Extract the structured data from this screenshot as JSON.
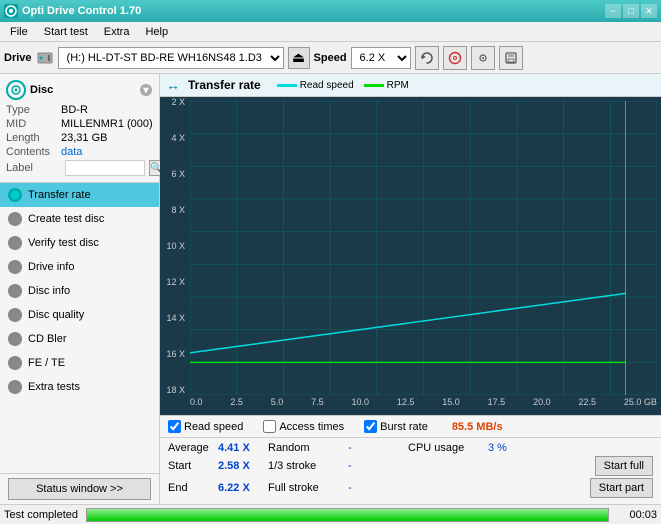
{
  "titlebar": {
    "title": "Opti Drive Control 1.70",
    "minimize": "−",
    "maximize": "□",
    "close": "✕"
  },
  "menu": {
    "items": [
      "File",
      "Start test",
      "Extra",
      "Help"
    ]
  },
  "drive_toolbar": {
    "drive_label": "Drive",
    "drive_value": "(H:)  HL-DT-ST BD-RE  WH16NS48 1.D3",
    "speed_label": "Speed",
    "speed_value": "6.2 X"
  },
  "disc": {
    "type_label": "Type",
    "type_value": "BD-R",
    "mid_label": "MID",
    "mid_value": "MILLENMR1 (000)",
    "length_label": "Length",
    "length_value": "23,31 GB",
    "contents_label": "Contents",
    "contents_value": "data",
    "label_label": "Label",
    "label_value": ""
  },
  "nav": {
    "items": [
      {
        "id": "transfer-rate",
        "label": "Transfer rate",
        "active": true
      },
      {
        "id": "create-test-disc",
        "label": "Create test disc",
        "active": false
      },
      {
        "id": "verify-test-disc",
        "label": "Verify test disc",
        "active": false
      },
      {
        "id": "drive-info",
        "label": "Drive info",
        "active": false
      },
      {
        "id": "disc-info",
        "label": "Disc info",
        "active": false
      },
      {
        "id": "disc-quality",
        "label": "Disc quality",
        "active": false
      },
      {
        "id": "cd-bler",
        "label": "CD Bler",
        "active": false
      },
      {
        "id": "fe-te",
        "label": "FE / TE",
        "active": false
      },
      {
        "id": "extra-tests",
        "label": "Extra tests",
        "active": false
      }
    ],
    "status_window_btn": "Status window >>"
  },
  "chart": {
    "title": "Transfer rate",
    "legend": [
      {
        "label": "Read speed",
        "color": "#00dddd"
      },
      {
        "label": "RPM",
        "color": "#00dd00"
      }
    ],
    "y_labels": [
      "18 X",
      "16 X",
      "14 X",
      "12 X",
      "10 X",
      "8 X",
      "6 X",
      "4 X",
      "2 X"
    ],
    "x_labels": [
      "0.0",
      "2.5",
      "5.0",
      "7.5",
      "10.0",
      "12.5",
      "15.0",
      "17.5",
      "20.0",
      "22.5",
      "25.0 GB"
    ],
    "checkboxes": [
      {
        "label": "Read speed",
        "checked": true
      },
      {
        "label": "Access times",
        "checked": false
      },
      {
        "label": "Burst rate",
        "checked": true
      }
    ],
    "burst_rate": "85.5 MB/s"
  },
  "stats": {
    "rows": [
      {
        "label1": "Average",
        "val1": "4.41 X",
        "label2": "Random",
        "val2": "-",
        "label3": "CPU usage",
        "val3": "3 %",
        "btn": null
      },
      {
        "label1": "Start",
        "val1": "2.58 X",
        "label2": "1/3 stroke",
        "val2": "-",
        "label3": "",
        "val3": "",
        "btn": "Start full"
      },
      {
        "label1": "End",
        "val1": "6.22 X",
        "label2": "Full stroke",
        "val2": "-",
        "label3": "",
        "val3": "",
        "btn": "Start part"
      }
    ]
  },
  "statusbar": {
    "text": "Test completed",
    "progress": 100,
    "time": "00:03"
  }
}
